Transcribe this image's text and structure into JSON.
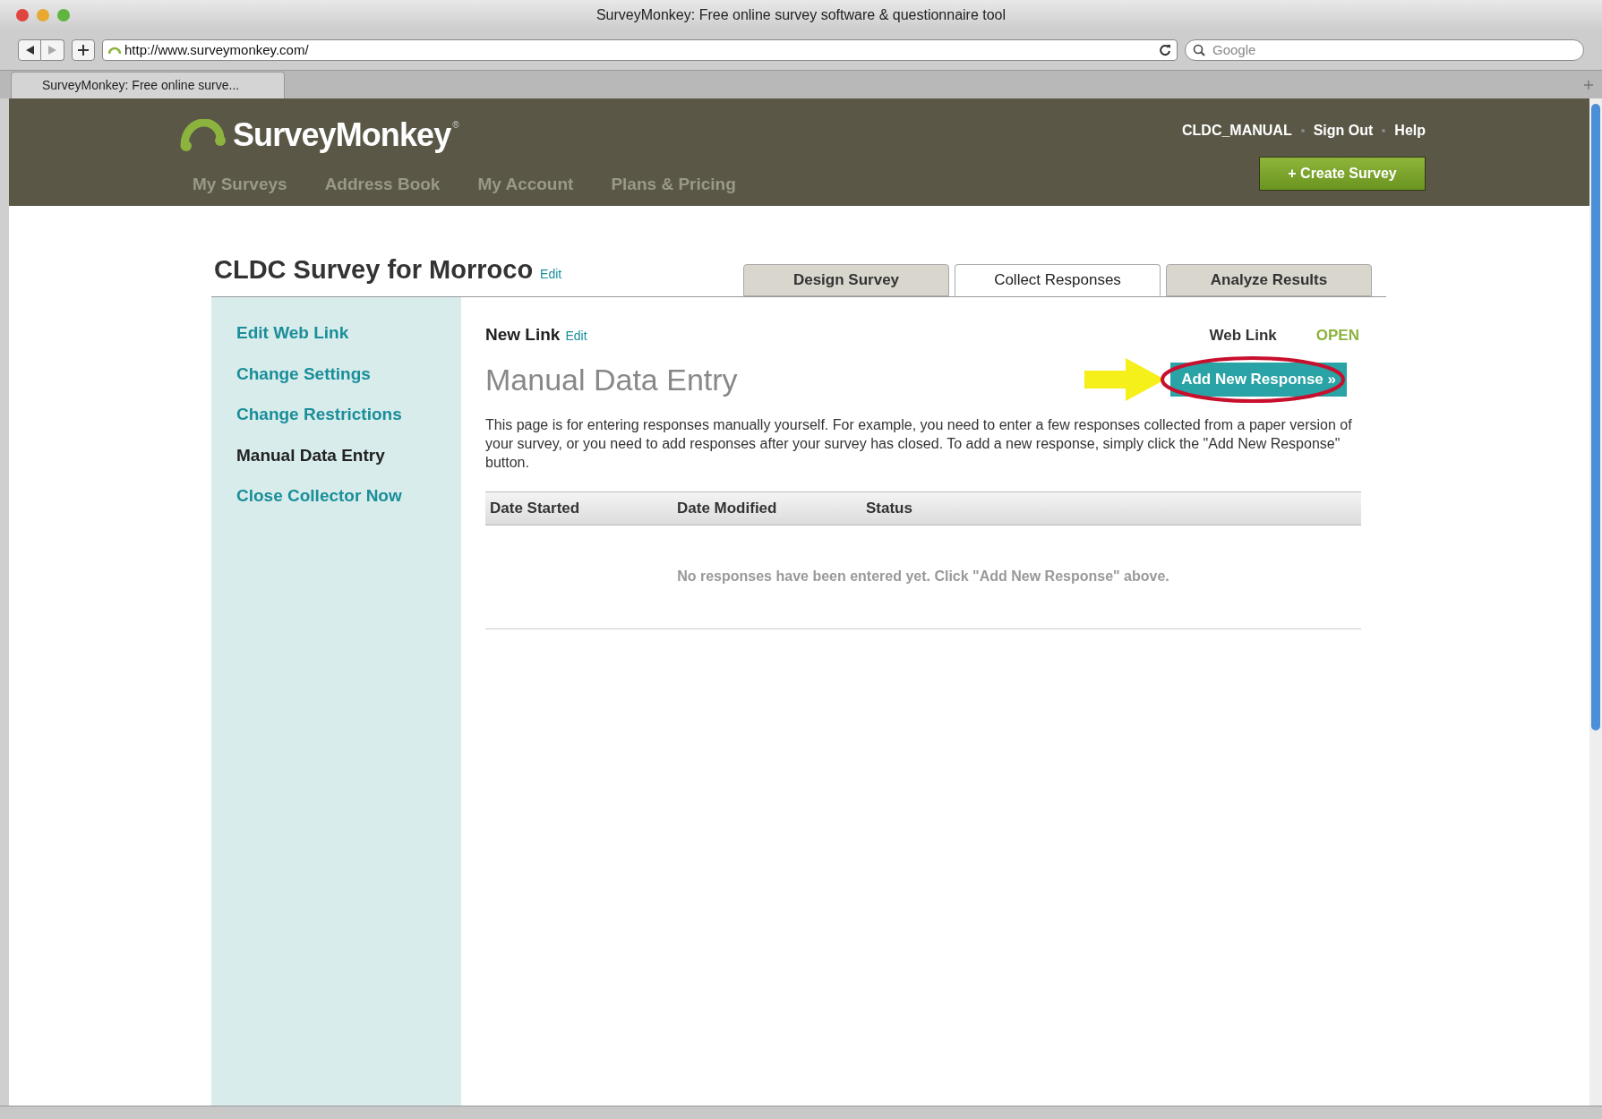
{
  "window": {
    "title": "SurveyMonkey: Free online survey software & questionnaire tool"
  },
  "toolbar": {
    "url": "http://www.surveymonkey.com/",
    "search_placeholder": "Google"
  },
  "browser_tabs": [
    {
      "label": "SurveyMonkey: Free online surve...",
      "selected": true
    }
  ],
  "header": {
    "logo": "SurveyMonkey",
    "logo_mark": "®",
    "user": "CLDC_MANUAL",
    "links": [
      "Sign Out",
      "Help"
    ],
    "nav": [
      "My Surveys",
      "Address Book",
      "My Account",
      "Plans & Pricing"
    ],
    "create_button": "+ Create Survey"
  },
  "survey": {
    "title": "CLDC Survey for Morroco",
    "edit": "Edit"
  },
  "tabs": [
    {
      "label": "Design Survey",
      "selected": false
    },
    {
      "label": "Collect Responses",
      "selected": true
    },
    {
      "label": "Analyze Results",
      "selected": false
    }
  ],
  "sidebar": {
    "items": [
      {
        "label": "Edit Web Link",
        "selected": false
      },
      {
        "label": "Change Settings",
        "selected": false
      },
      {
        "label": "Change Restrictions",
        "selected": false
      },
      {
        "label": "Manual Data Entry",
        "selected": true
      },
      {
        "label": "Close Collector Now",
        "selected": false
      }
    ]
  },
  "collector": {
    "name": "New Link",
    "edit": "Edit",
    "type": "Web Link",
    "status": "OPEN"
  },
  "main": {
    "heading": "Manual Data Entry",
    "add_button": "Add New Response »",
    "description": "This page is for entering responses manually yourself. For example, you need to enter a few responses collected from a paper version of your survey, or you need to add responses after your survey has closed. To add a new response, simply click the \"Add New Response\" button."
  },
  "table": {
    "columns": [
      "Date Started",
      "Date Modified",
      "Status"
    ],
    "empty_message": "No responses have been entered yet. Click \"Add New Response\" above."
  }
}
